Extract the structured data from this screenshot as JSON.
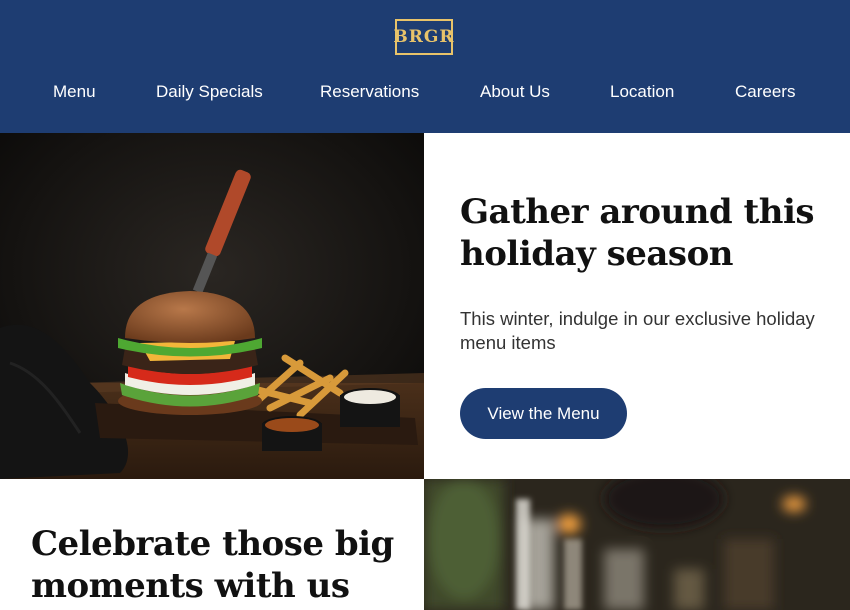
{
  "header": {
    "logo_text": "BRGR",
    "nav": [
      {
        "label": "Menu"
      },
      {
        "label": "Daily Specials"
      },
      {
        "label": "Reservations"
      },
      {
        "label": "About Us"
      },
      {
        "label": "Location"
      },
      {
        "label": "Careers"
      }
    ]
  },
  "hero": {
    "image": "burger-with-fries-photo",
    "title_line1": "Gather around this",
    "title_line2": "holiday season",
    "subtitle_line1": "This winter, indulge in our exclusive holiday",
    "subtitle_line2": "menu items",
    "cta_label": "View the Menu"
  },
  "section2": {
    "title_line1": "Celebrate those big",
    "title_line2": "moments with us",
    "image": "blurred-restaurant-interior-photo"
  },
  "colors": {
    "brand_navy": "#1e3d72",
    "logo_gold": "#e8c36a"
  }
}
